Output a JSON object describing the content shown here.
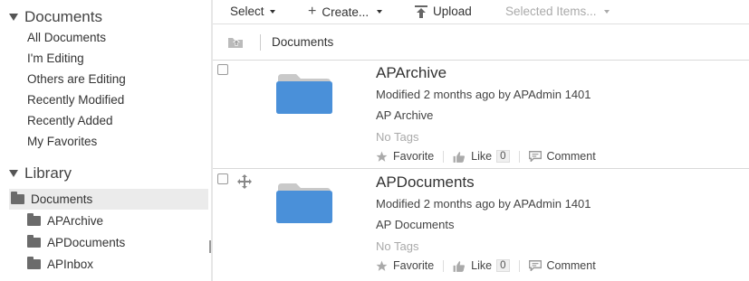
{
  "sidebar": {
    "documents_heading": "Documents",
    "nav": [
      {
        "label": "All Documents"
      },
      {
        "label": "I'm Editing"
      },
      {
        "label": "Others are Editing"
      },
      {
        "label": "Recently Modified"
      },
      {
        "label": "Recently Added"
      },
      {
        "label": "My Favorites"
      }
    ],
    "library_heading": "Library",
    "library": [
      {
        "label": "Documents",
        "selected": true
      },
      {
        "label": "APArchive"
      },
      {
        "label": "APDocuments"
      },
      {
        "label": "APInbox"
      }
    ]
  },
  "toolbar": {
    "select_label": "Select",
    "create_label": "Create...",
    "upload_label": "Upload",
    "selected_items_label": "Selected Items..."
  },
  "breadcrumb": {
    "current": "Documents"
  },
  "items": [
    {
      "name": "APArchive",
      "modified": "Modified 2 months ago by APAdmin 1401",
      "description": "AP Archive",
      "tags": "No Tags",
      "favorite_label": "Favorite",
      "like_label": "Like",
      "like_count": "0",
      "comment_label": "Comment"
    },
    {
      "name": "APDocuments",
      "modified": "Modified 2 months ago by APAdmin 1401",
      "description": "AP Documents",
      "tags": "No Tags",
      "favorite_label": "Favorite",
      "like_label": "Like",
      "like_count": "0",
      "comment_label": "Comment"
    }
  ],
  "colors": {
    "folder_blue": "#4a90d9",
    "folder_tab": "#c9c9c9",
    "selected_bg": "#ebebeb"
  },
  "icons": [
    "folder-icon",
    "upload-icon",
    "parent-folder-icon",
    "move-icon",
    "star-icon",
    "thumbs-up-icon",
    "comment-icon",
    "plus-icon"
  ]
}
